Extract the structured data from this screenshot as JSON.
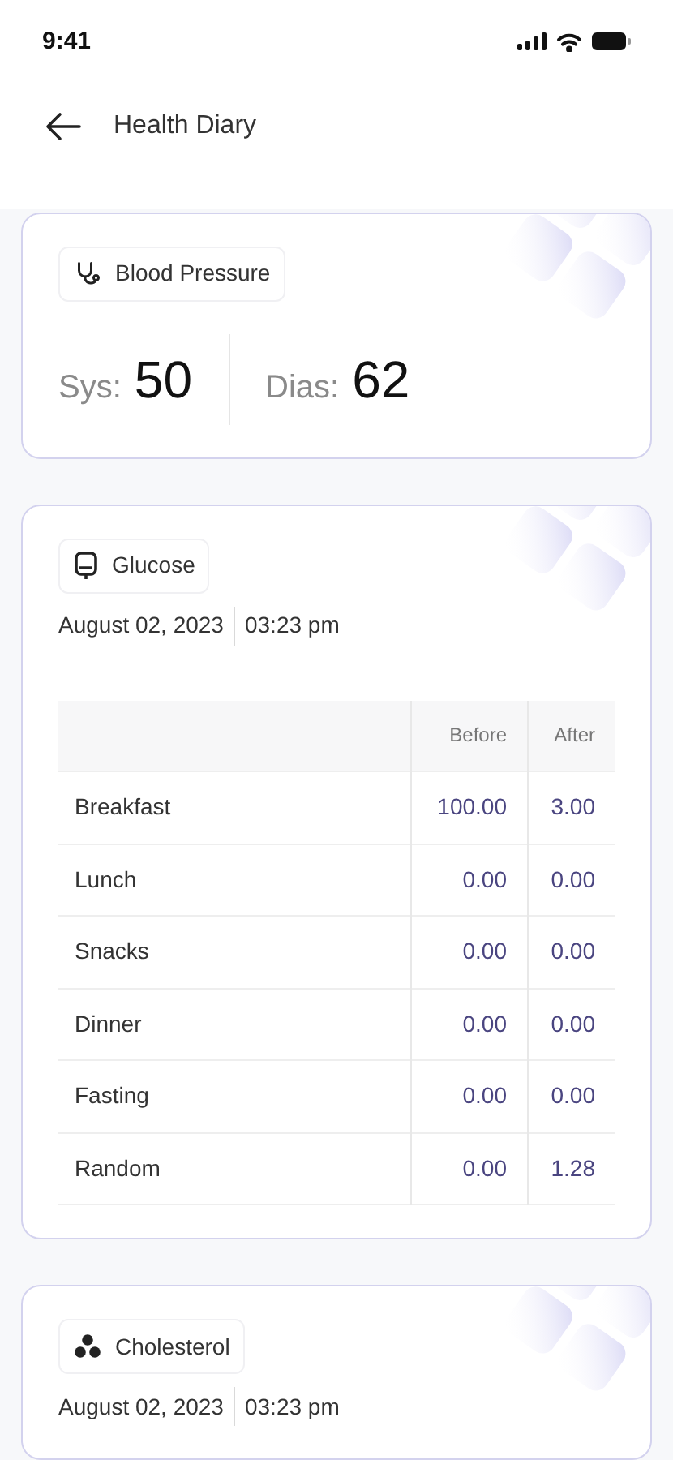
{
  "status_bar": {
    "time": "9:41"
  },
  "header": {
    "title": "Health Diary"
  },
  "cards": [
    {
      "kind": "pressure",
      "label": "Blood Pressure",
      "readings": [
        {
          "label": "Sys:",
          "value": "50"
        },
        {
          "label": "Dias:",
          "value": "62"
        }
      ]
    },
    {
      "kind": "glucose",
      "label": "Glucose",
      "date": "August 02, 2023",
      "time": "03:23 pm",
      "table": {
        "columns": [
          "Before",
          "After"
        ],
        "rows": [
          {
            "meal": "Breakfast",
            "before": "100.00",
            "after": "3.00"
          },
          {
            "meal": "Lunch",
            "before": "0.00",
            "after": "0.00"
          },
          {
            "meal": "Snacks",
            "before": "0.00",
            "after": "0.00"
          },
          {
            "meal": "Dinner",
            "before": "0.00",
            "after": "0.00"
          },
          {
            "meal": "Fasting",
            "before": "0.00",
            "after": "0.00"
          },
          {
            "meal": "Random",
            "before": "0.00",
            "after": "1.28"
          }
        ]
      }
    },
    {
      "kind": "cholesterol",
      "label": "Cholesterol",
      "date": "August 02, 2023",
      "time": "03:23 pm"
    }
  ]
}
